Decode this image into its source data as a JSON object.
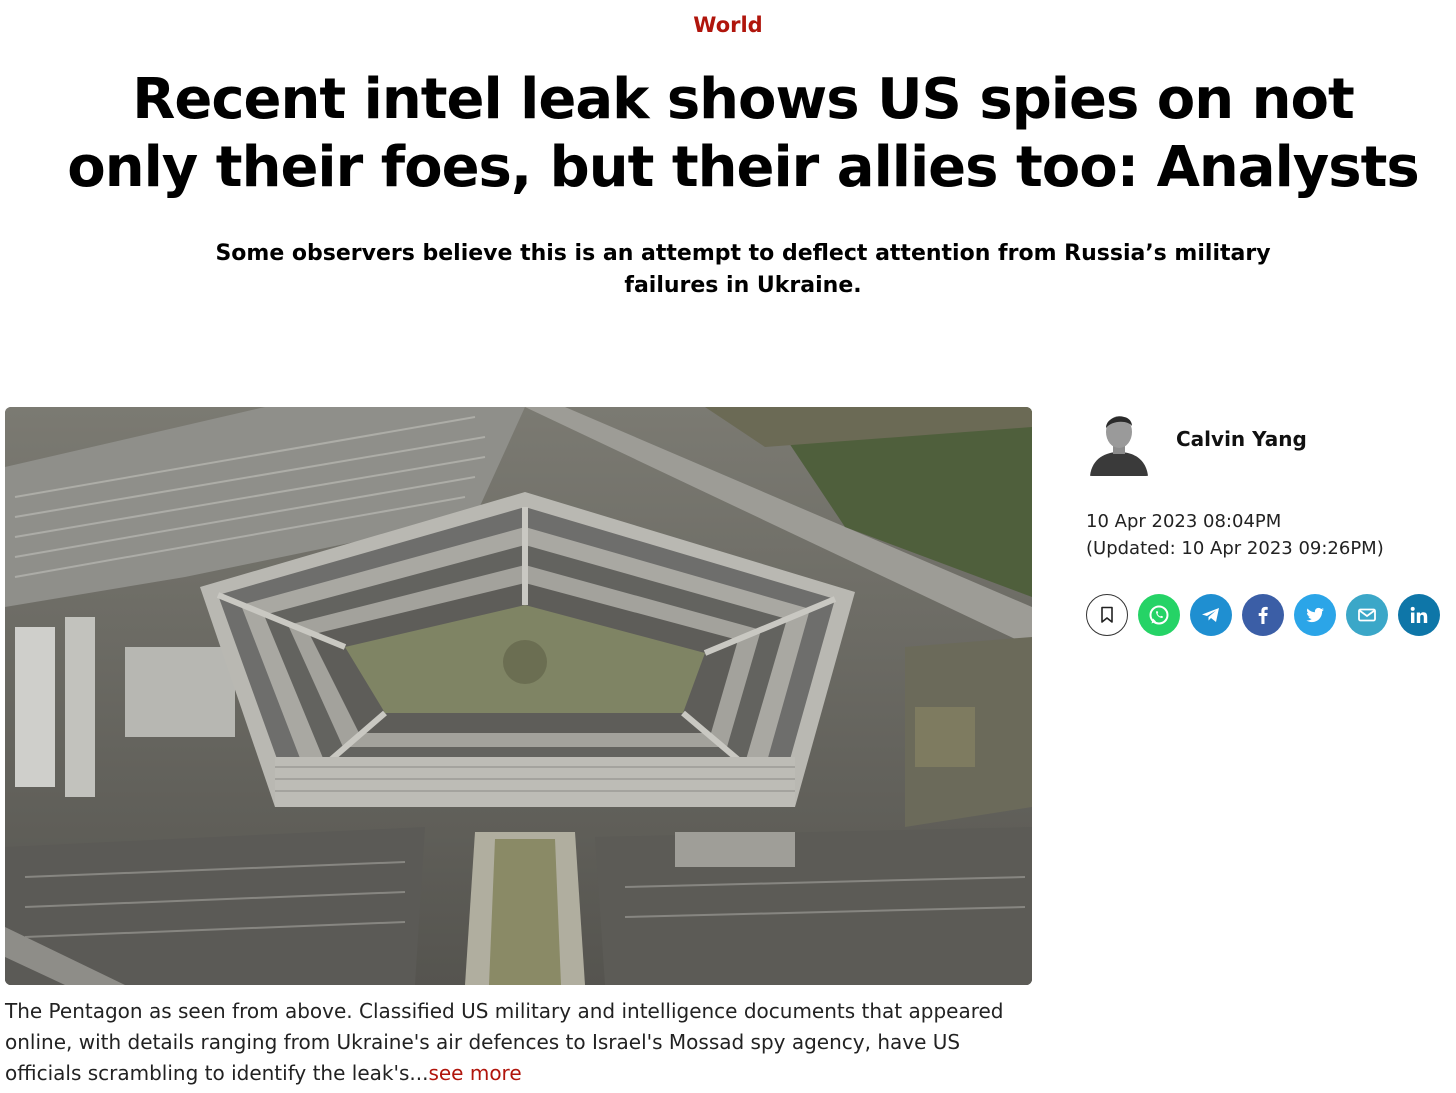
{
  "section": {
    "label": "World"
  },
  "article": {
    "headline": "Recent intel leak shows US spies on not only their foes, but their allies too: Analysts",
    "subheadline": "Some observers believe this is an attempt to deflect attention from Russia’s military failures in Ukraine."
  },
  "hero_image": {
    "alt": "The Pentagon as seen from above",
    "caption_text": "The Pentagon as seen from above. Classified US military and intelligence documents that appeared online, with details ranging from Ukraine's air defences to Israel's Mossad spy agency, have US officials scrambling to identify the leak's...",
    "see_more_label": "see more"
  },
  "author": {
    "name": "Calvin Yang"
  },
  "dates": {
    "published": "10 Apr 2023 08:04PM",
    "updated": "(Updated: 10 Apr 2023 09:26PM)"
  },
  "share": {
    "buttons": [
      {
        "name": "bookmark",
        "icon": "bookmark-icon",
        "color": "#ffffff"
      },
      {
        "name": "whatsapp",
        "icon": "whatsapp-icon",
        "color": "#25d366"
      },
      {
        "name": "telegram",
        "icon": "telegram-icon",
        "color": "#1f8fd1"
      },
      {
        "name": "facebook",
        "icon": "facebook-icon",
        "color": "#3b5ea6"
      },
      {
        "name": "twitter",
        "icon": "twitter-icon",
        "color": "#2ba5e8"
      },
      {
        "name": "email",
        "icon": "email-icon",
        "color": "#3ba7c8"
      },
      {
        "name": "linkedin",
        "icon": "linkedin-icon",
        "color": "#0e76a8"
      }
    ]
  },
  "colors": {
    "accent": "#b0150c",
    "text": "#000000"
  }
}
